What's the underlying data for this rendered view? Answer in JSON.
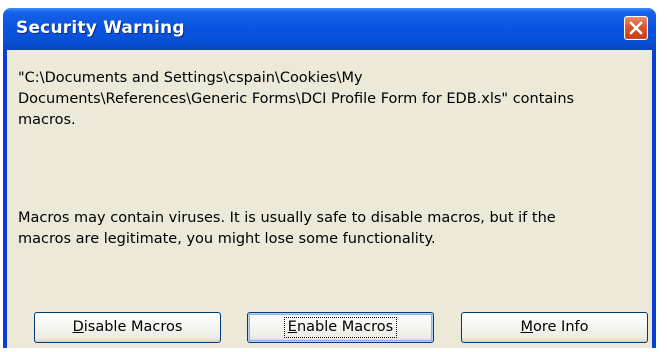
{
  "window": {
    "title": "Security Warning"
  },
  "message": {
    "file_lines": [
      "\"C:\\Documents and Settings\\cspain\\Cookies\\My",
      "Documents\\References\\Generic Forms\\DCI Profile Form for EDB.xls\" contains",
      "macros."
    ],
    "warning_lines": [
      "Macros may contain viruses. It is usually safe to disable macros, but if the",
      "macros are legitimate, you might lose some functionality."
    ]
  },
  "buttons": {
    "disable": {
      "hotkey": "D",
      "rest": "isable Macros"
    },
    "enable": {
      "hotkey": "E",
      "rest": "nable Macros"
    },
    "more": {
      "hotkey": "M",
      "rest": "ore Info"
    }
  },
  "colors": {
    "titlebar": "#0a55e0",
    "client": "#ece9d8",
    "close": "#d8542c"
  },
  "icons": {
    "close": "close-icon"
  }
}
